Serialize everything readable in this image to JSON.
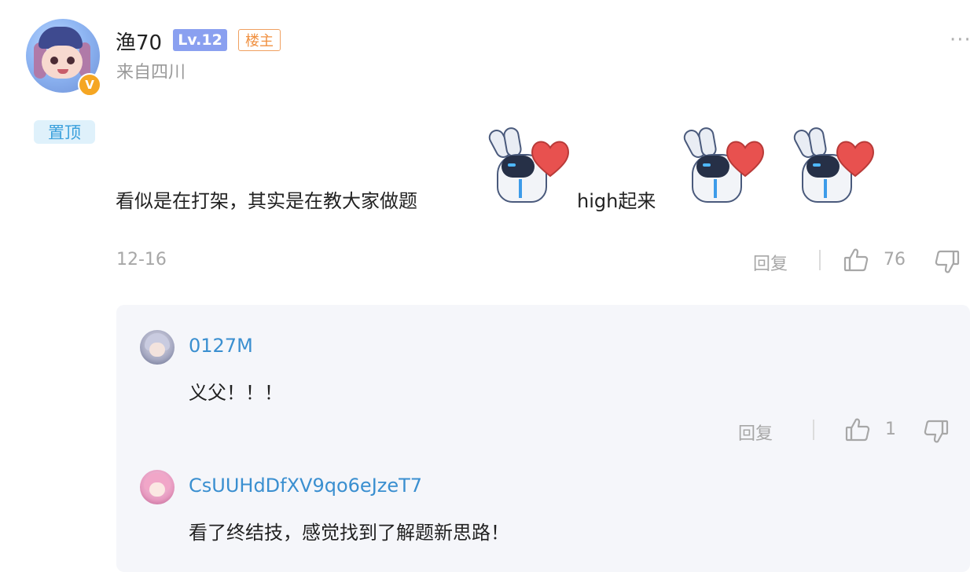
{
  "post": {
    "username": "渔70",
    "level_badge": "Lv.12",
    "op_badge": "楼主",
    "location": "来自四川",
    "more_icon": "more-dots-icon",
    "verified_badge": "V",
    "pinned_tag": "置顶",
    "content_text": "看似是在打架，其实是在教大家做题",
    "content_text_2": "high起来",
    "date": "12-16",
    "reply_label": "回复",
    "like_count": "76"
  },
  "replies": [
    {
      "username": "0127M",
      "text": "义父！！！",
      "reply_label": "回复",
      "like_count": "1"
    },
    {
      "username": "CsUUHdDfXV9qo6eJzeT7",
      "text": "看了终结技，感觉找到了解题新思路！"
    }
  ],
  "colors": {
    "accent_blue": "#3a8fd0",
    "level_badge_bg": "#8aa0f0",
    "op_badge_border": "#f0a060",
    "pinned_bg": "#dff1fb",
    "muted_gray": "#a7a7a7",
    "panel_bg": "#f5f6fa",
    "heart_red": "#e8514f"
  }
}
